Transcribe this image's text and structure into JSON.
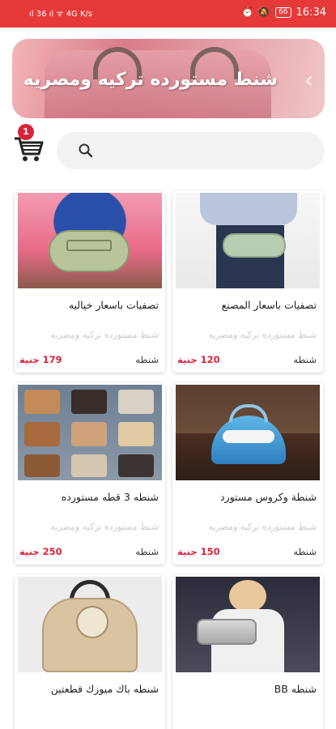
{
  "status_bar": {
    "left_icons": "ıl 36 ıl ᯤ 4G K/s",
    "right_icons": "⏰ 🔕",
    "battery": "66",
    "time": "16:34"
  },
  "banner": {
    "title": "شنط مستورده تركيه ومصريه",
    "arrow": "‹"
  },
  "cart": {
    "badge": "1"
  },
  "search": {
    "value": "",
    "placeholder": ""
  },
  "products": [
    {
      "name": "تصفيات باسعار خياليه",
      "sub": "شنط مستورده تركيه ومصريه",
      "category": "شنطه",
      "price": "179 جنية"
    },
    {
      "name": "تصفيات باسعار المصنع",
      "sub": "شنط مستورده تركيه ومصريه",
      "category": "شنطه",
      "price": "120 جنية"
    },
    {
      "name": "شنطه 3 قطه مستورده",
      "sub": "شنط مستورده تركيه ومصريه",
      "category": "شنطه",
      "price": "250 جنية"
    },
    {
      "name": "شنطة وكروس مستورد",
      "sub": "شنط مستورده تركيه ومصريه",
      "category": "شنطه",
      "price": "150 جنية"
    },
    {
      "name": "شنطه باك ميوزك قطعتين",
      "sub": "",
      "category": "",
      "price": ""
    },
    {
      "name": "شنطه BB",
      "sub": "",
      "category": "",
      "price": ""
    }
  ],
  "colors": {
    "accent": "#e63939",
    "price": "#d8243a"
  }
}
